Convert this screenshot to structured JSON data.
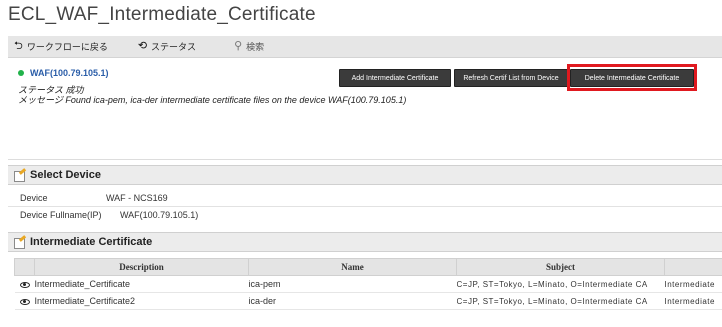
{
  "page": {
    "title": "ECL_WAF_Intermediate_Certificate"
  },
  "toolbar": {
    "back_label": "ワークフローに戻る",
    "status_label": "ステータス",
    "search_label": "検索"
  },
  "status": {
    "device": "WAF(100.79.105.1)",
    "status_text": "ステータス 成功",
    "message": "メッセージ Found ica-pem, ica-der intermediate certificate files on the device WAF(100.79.105.1)",
    "indicator_color": "#21b24a"
  },
  "actions": {
    "add_label": "Add Intermediate Certificate",
    "refresh_label": "Refresh Certif List from Device",
    "delete_label": "Delete Intermediate Certificate",
    "highlight_color": "#e0191f"
  },
  "select_device": {
    "header": "Select Device",
    "device_label": "Device",
    "device_value": "WAF - NCS169",
    "fullname_label": "Device Fullname(IP)",
    "fullname_value": "WAF(100.79.105.1)"
  },
  "intermediate": {
    "header": "Intermediate Certificate",
    "columns": [
      "",
      "Description",
      "Name",
      "Subject",
      ""
    ],
    "rows": [
      {
        "icon": "eye-icon",
        "description": "Intermediate_Certificate",
        "name": "ica-pem",
        "subject": "C=JP, ST=Tokyo, L=Minato, O=Intermediate CA",
        "extra": "Intermediate"
      },
      {
        "icon": "eye-icon",
        "description": "Intermediate_Certificate2",
        "name": "ica-der",
        "subject": "C=JP, ST=Tokyo, L=Minato, O=Intermediate CA",
        "extra": "Intermediate"
      }
    ]
  }
}
